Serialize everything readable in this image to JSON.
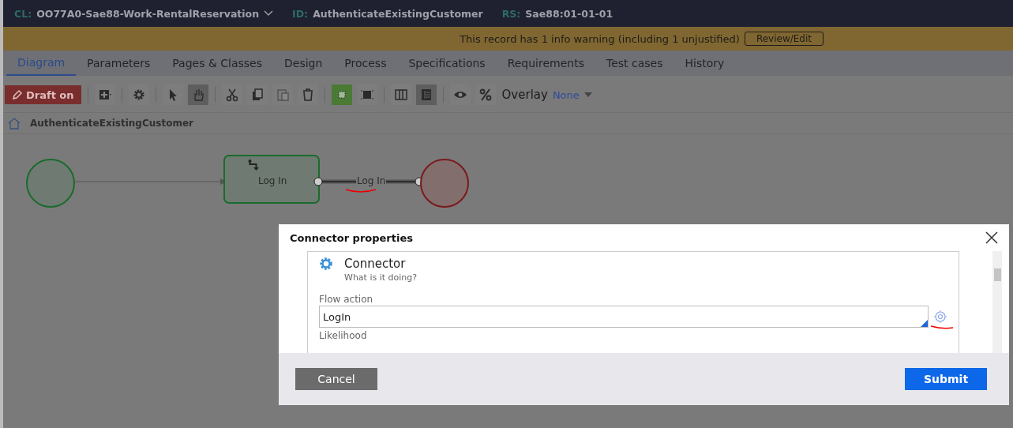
{
  "header": {
    "class_label": "CL:",
    "class_value": "OO77A0-Sae88-Work-RentalReservation",
    "id_label": "ID:",
    "id_value": "AuthenticateExistingCustomer",
    "rs_label": "RS:",
    "rs_value": "Sae88:01-01-01"
  },
  "warning": {
    "message": "This record has 1 info warning (including 1 unjustified)",
    "button": "Review/Edit"
  },
  "tabs": [
    {
      "label": "Diagram",
      "selected": true
    },
    {
      "label": "Parameters",
      "selected": false
    },
    {
      "label": "Pages & Classes",
      "selected": false
    },
    {
      "label": "Design",
      "selected": false
    },
    {
      "label": "Process",
      "selected": false
    },
    {
      "label": "Specifications",
      "selected": false
    },
    {
      "label": "Requirements",
      "selected": false
    },
    {
      "label": "Test cases",
      "selected": false
    },
    {
      "label": "History",
      "selected": false
    }
  ],
  "toolbar": {
    "draft_button": "Draft on",
    "tool_groups": [
      {
        "tools": [
          {
            "kind": "add",
            "selected": false
          }
        ]
      },
      {
        "tools": [
          {
            "kind": "gear",
            "selected": false
          }
        ]
      },
      {
        "tools": [
          {
            "kind": "pointer",
            "selected": false
          },
          {
            "kind": "hand",
            "selected": true
          }
        ]
      },
      {
        "tools": [
          {
            "kind": "cut",
            "selected": false
          },
          {
            "kind": "copy",
            "selected": false
          },
          {
            "kind": "paste",
            "selected": false
          },
          {
            "kind": "delete",
            "selected": false
          }
        ]
      },
      {
        "tools": [
          {
            "kind": "grid",
            "selected": true
          },
          {
            "kind": "fit",
            "selected": false
          }
        ]
      },
      {
        "tools": [
          {
            "kind": "columns",
            "selected": false
          },
          {
            "kind": "rows",
            "selected": true
          }
        ]
      },
      {
        "tools": [
          {
            "kind": "eye",
            "selected": false
          },
          {
            "kind": "percent",
            "selected": false
          }
        ]
      }
    ],
    "overlay_label": "Overlay",
    "overlay_value": "None"
  },
  "breadcrumb": "AuthenticateExistingCustomer",
  "diagram": {
    "shape_label": "Log In",
    "connector_label": "Log In"
  },
  "dialog": {
    "title": "Connector properties",
    "section_title": "Connector",
    "section_subtitle": "What is it doing?",
    "field_label": "Flow action",
    "field_value": "LogIn",
    "next_label": "Likelihood",
    "cancel": "Cancel",
    "submit": "Submit"
  }
}
